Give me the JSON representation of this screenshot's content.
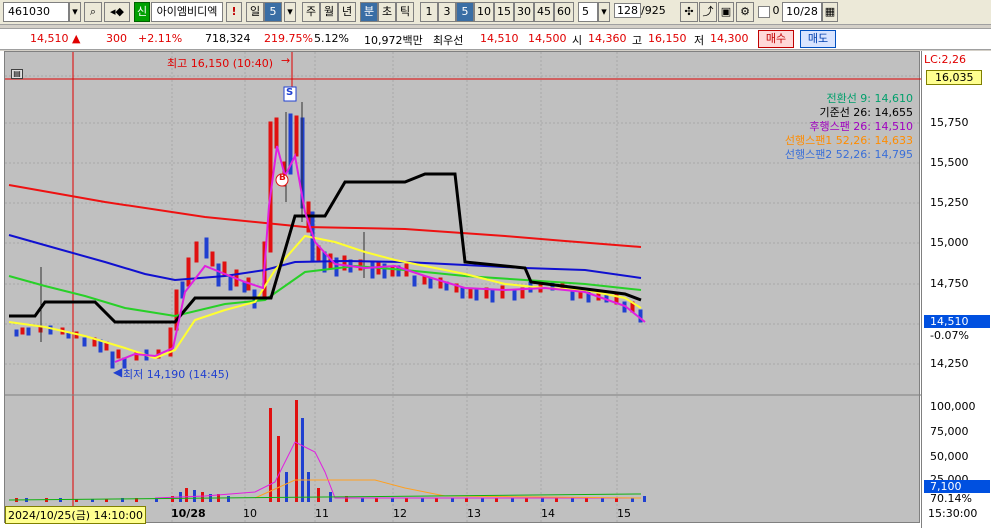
{
  "toolbar": {
    "code": "461030",
    "credit_badge": "신",
    "stock_name": "아이엠비디엑",
    "warning": "!",
    "periods": [
      "일",
      "5",
      "주",
      "월",
      "년",
      "분",
      "초",
      "틱",
      "1",
      "3",
      "5",
      "10",
      "15",
      "30",
      "45",
      "60"
    ],
    "selected_period": "5",
    "unit": "5",
    "count": "128",
    "total": "/925",
    "checkbox_label": "0",
    "date": "10/28"
  },
  "info": {
    "price": "14,510",
    "change": "300",
    "change_pct": "+2.11%",
    "volume": "718,324",
    "volume_ratio": "219.75%",
    "turnover": "5.12%",
    "amount": "10,972백만",
    "best_bid_label": "최우선",
    "best_bid": "14,510",
    "best_ask": "14,500",
    "open_label": "시",
    "open": "14,360",
    "high_label": "고",
    "high": "16,150",
    "low_label": "저",
    "low": "14,300",
    "buy_button": "매수",
    "sell_button": "매도"
  },
  "annotations": {
    "high_marker": "최고 16,150 (10:40)",
    "low_marker": "최저 14,190 (14:45)",
    "signal_s": "S",
    "signal_b": "B"
  },
  "legend": [
    {
      "label": "전환선 9: 14,610",
      "color": "#009f6b"
    },
    {
      "label": "기준선 26: 14,655",
      "color": "#000000"
    },
    {
      "label": "후행스팬 26: 14,510",
      "color": "#a000c0"
    },
    {
      "label": "선행스팬1 52,26: 14,633",
      "color": "#ff8c00"
    },
    {
      "label": "선행스팬2 52,26: 14,795",
      "color": "#3a6fd8"
    }
  ],
  "price_axis": {
    "lc_label": "LC:2,26",
    "top_value": "16,035",
    "ticks": [
      "15,750",
      "15,500",
      "15,250",
      "15,000",
      "14,750",
      "14,250"
    ],
    "current": "14,510",
    "current_pct": "-0.07%"
  },
  "volume_axis": {
    "ticks": [
      "100,000",
      "75,000",
      "50,000",
      "25,000"
    ],
    "current": "7,100",
    "current_pct": "70.14%"
  },
  "time_axis": {
    "cursor_label": "2024/10/25(금) 14:10:00",
    "labels": [
      "10/28",
      "10",
      "11",
      "12",
      "13",
      "14",
      "15",
      "15:30:00"
    ]
  }
}
